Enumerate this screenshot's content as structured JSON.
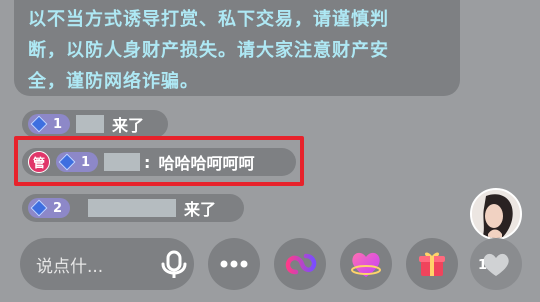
{
  "notice": {
    "lines": [
      "以不当方式诱导打赏、私下交易，请谨慎判",
      "断，以防人身财产损失。请大家注意财产安",
      "全，谨防网络诈骗。"
    ]
  },
  "messages": [
    {
      "level": "1",
      "action": "来了"
    },
    {
      "role_badge": "管",
      "level": "1",
      "separator": ":",
      "text": "哈哈哈呵呵呵"
    },
    {
      "level": "2",
      "action": "来了"
    }
  ],
  "input": {
    "placeholder": "说点什..."
  },
  "toolbar": {
    "icons": [
      "mic-icon",
      "more-icon",
      "link-icon",
      "heart-gift-icon",
      "gift-box-icon",
      "like-icon"
    ],
    "like_count": "1"
  },
  "colors": {
    "notice_text": "#aee8f4",
    "level_badge": "#8d88c8",
    "highlight_border": "#e7222b",
    "admin_badge": "#e0366a"
  }
}
